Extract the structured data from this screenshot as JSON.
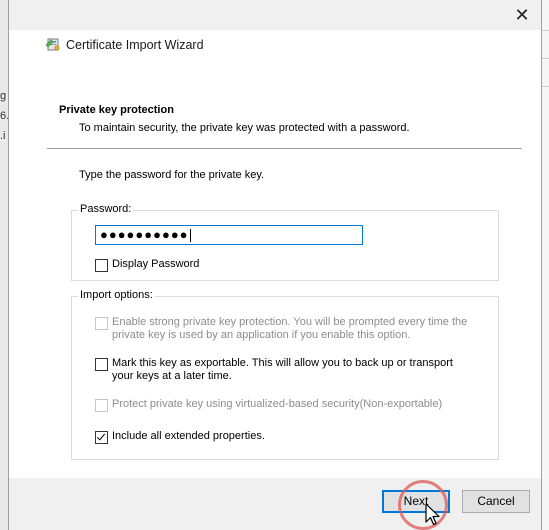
{
  "background": {
    "left_fragments": [
      "g",
      "6.",
      ".i"
    ]
  },
  "dialog": {
    "close_glyph": "✕",
    "back_glyph": "←",
    "title": "Certificate Import Wizard",
    "section_heading": "Private key protection",
    "section_description": "To maintain security, the private key was protected with a password.",
    "instruction": "Type the password for the private key.",
    "password": {
      "label": "Password:",
      "value": "●●●●●●●●●●",
      "display_password_label": "Display Password",
      "display_password_checked": false
    },
    "import_options": {
      "label": "Import options:",
      "options": [
        {
          "label": "Enable strong private key protection. You will be prompted every time the private key is used by an application if you enable this option.",
          "checked": false,
          "disabled": true
        },
        {
          "label": "Mark this key as exportable. This will allow you to back up or transport your keys at a later time.",
          "checked": false,
          "disabled": false
        },
        {
          "label": "Protect private key using virtualized-based security(Non-exportable)",
          "checked": false,
          "disabled": true
        },
        {
          "label": "Include all extended properties.",
          "checked": true,
          "disabled": false
        }
      ]
    },
    "buttons": {
      "next": "Next",
      "cancel": "Cancel"
    }
  },
  "colors": {
    "accent": "#0078d7",
    "click_highlight": "#dc5a5a"
  }
}
